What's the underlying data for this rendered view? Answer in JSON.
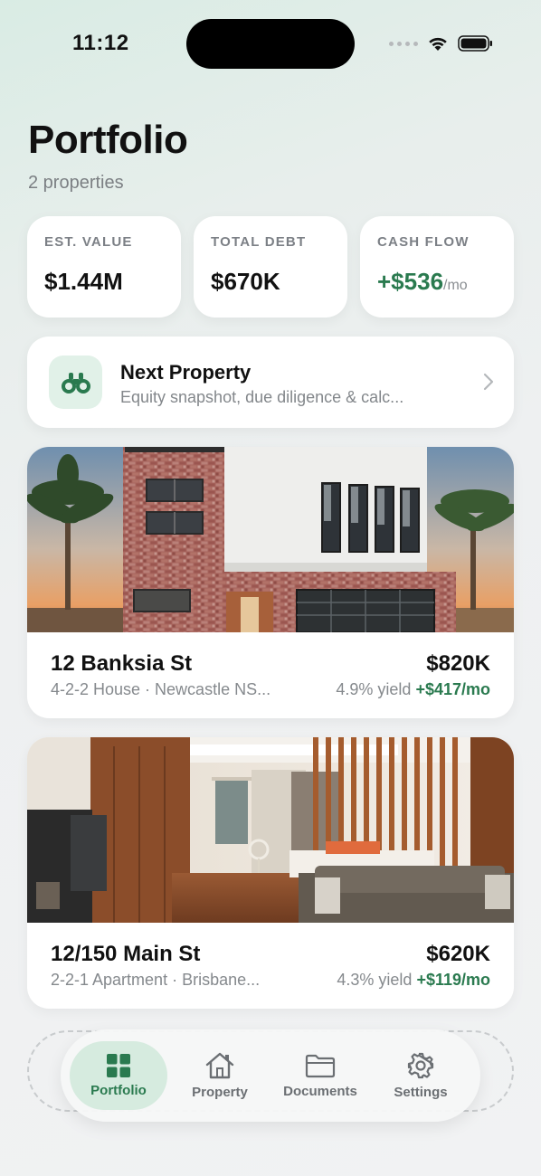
{
  "status_bar": {
    "time": "11:12"
  },
  "header": {
    "title": "Portfolio",
    "subtitle": "2 properties"
  },
  "stats": [
    {
      "label": "EST. VALUE",
      "value": "$1.44M",
      "unit": ""
    },
    {
      "label": "TOTAL DEBT",
      "value": "$670K",
      "unit": ""
    },
    {
      "label": "CASH FLOW",
      "value": "+$536",
      "unit": "/mo"
    }
  ],
  "next_property": {
    "title": "Next Property",
    "description": "Equity snapshot, due diligence & calc..."
  },
  "properties": [
    {
      "name": "12 Banksia St",
      "price": "$820K",
      "meta": "4-2-2 House · Newcastle NS...",
      "yield": "4.9% yield",
      "cash_flow": "+$417/mo"
    },
    {
      "name": "12/150 Main St",
      "price": "$620K",
      "meta": "2-2-1 Apartment · Brisbane...",
      "yield": "4.3% yield",
      "cash_flow": "+$119/mo"
    }
  ],
  "tabs": [
    {
      "label": "Portfolio",
      "icon": "grid-icon",
      "active": true
    },
    {
      "label": "Property",
      "icon": "house-icon",
      "active": false
    },
    {
      "label": "Documents",
      "icon": "folder-icon",
      "active": false
    },
    {
      "label": "Settings",
      "icon": "gear-icon",
      "active": false
    }
  ],
  "colors": {
    "accent_green": "#2a7a4f",
    "accent_green_light": "#d6ebdf"
  }
}
